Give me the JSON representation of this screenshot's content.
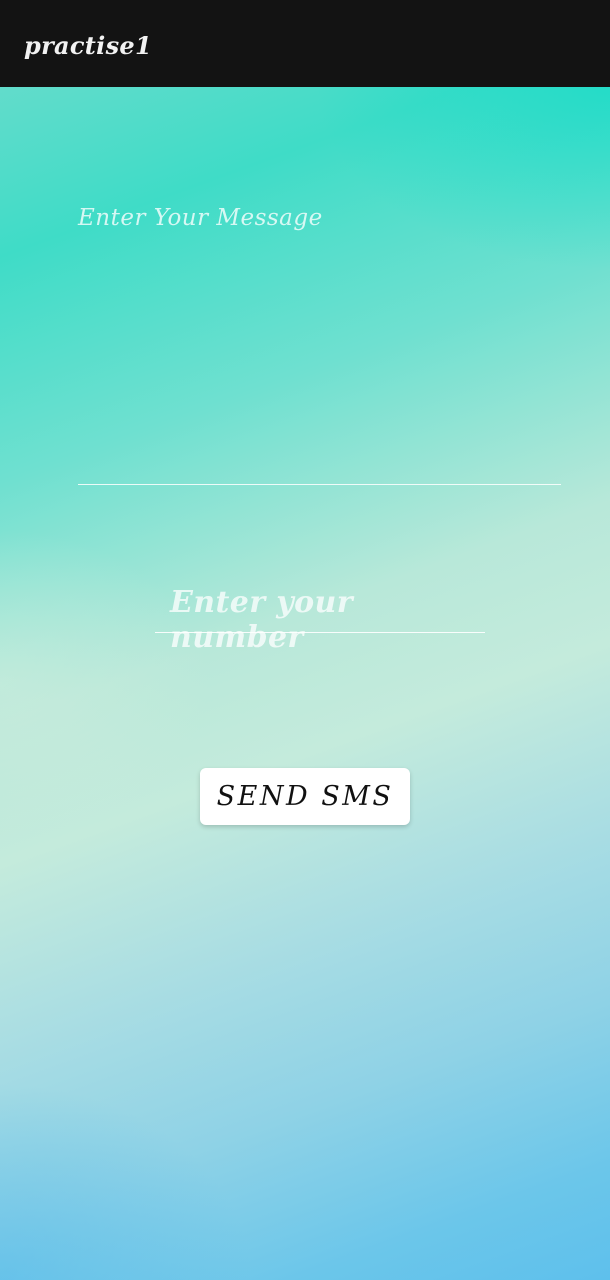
{
  "app_bar": {
    "title": "practise1"
  },
  "form": {
    "message_placeholder": "Enter Your Message",
    "message_value": "",
    "number_placeholder": "Enter your number",
    "number_value": "",
    "send_button_label": "SEND SMS"
  },
  "colors": {
    "app_bar_background": "#131313",
    "gradient_top": "#3fdcc7",
    "gradient_middle": "#c4ebdc",
    "gradient_bottom": "#5ec0ec",
    "button_background": "#ffffff"
  }
}
